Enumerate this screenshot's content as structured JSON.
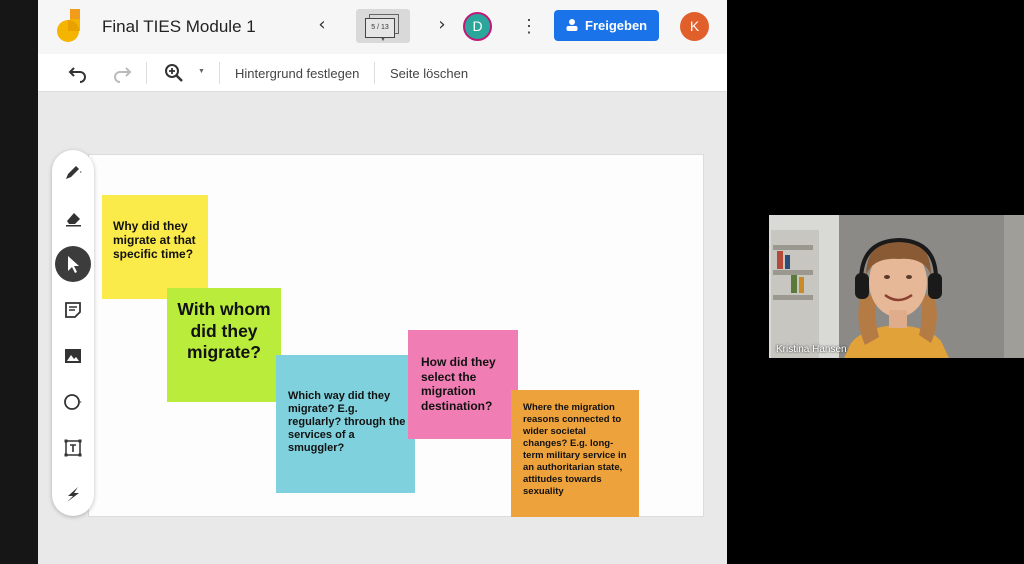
{
  "board": {
    "title": "Final TIES Module 1",
    "frame_counter": "5 / 13",
    "share_label": "Freigeben",
    "collaborator_initial": "D",
    "user_initial": "K"
  },
  "toolbar": {
    "set_background": "Hintergrund festlegen",
    "delete_frame": "Seite löschen"
  },
  "tools": [
    "pen-icon",
    "eraser-icon",
    "select-icon",
    "sticky-note-icon",
    "image-icon",
    "shape-circle-icon",
    "text-box-icon",
    "laser-icon"
  ],
  "notes": [
    {
      "text": "Why did they migrate at that specific time?",
      "color": "#fbeb4a"
    },
    {
      "text": "With whom did they migrate?",
      "color": "#b9ec3b"
    },
    {
      "text": "Which way did they migrate? E.g. regularly? through the services of a smuggler?",
      "color": "#7fd1dd"
    },
    {
      "text": "How did they select the migration destination?",
      "color": "#f07db4"
    },
    {
      "text": "Where the migration reasons connected to wider societal changes? E.g. long-term military service in an authoritarian state, attitudes towards sexuality",
      "color": "#eea23b"
    }
  ],
  "video": {
    "participant_name": "Kristina Hansen"
  },
  "colors": {
    "share_button": "#1a73e8",
    "avatar_k": "#e15f2b",
    "avatar_d": "#2aa69a"
  }
}
